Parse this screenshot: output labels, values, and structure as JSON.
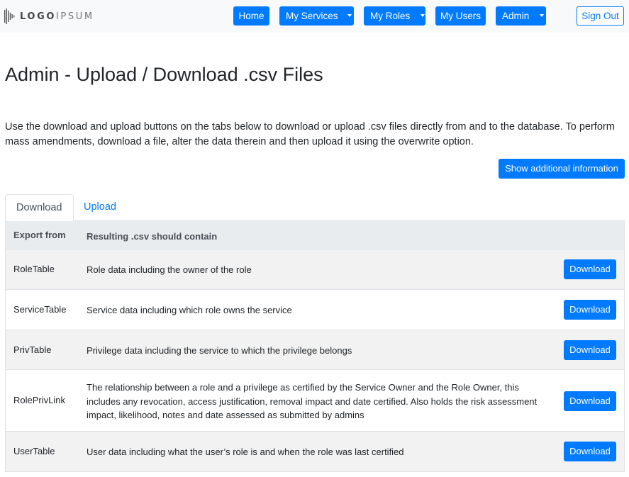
{
  "brand": {
    "logo_bold": "LOGO",
    "logo_light": "IPSUM"
  },
  "nav": {
    "home": "Home",
    "my_services": "My Services",
    "my_roles": "My Roles",
    "my_users": "My Users",
    "admin": "Admin",
    "sign_out": "Sign Out"
  },
  "page": {
    "title": "Admin - Upload / Download .csv Files",
    "intro": "Use the download and upload buttons on the tabs below to download or upload .csv files directly from and to the database. To perform mass amendments, download a file, alter the data therein and then upload it using the overwrite option.",
    "info_button": "Show additional information"
  },
  "tabs": [
    {
      "label": "Download",
      "active": true
    },
    {
      "label": "Upload",
      "active": false
    }
  ],
  "table": {
    "headers": [
      "Export from",
      "Resulting .csv should contain"
    ],
    "rows": [
      {
        "name": "RoleTable",
        "desc": "Role data including the owner of the role",
        "action": "Download"
      },
      {
        "name": "ServiceTable",
        "desc": "Service data including which role owns the service",
        "action": "Download"
      },
      {
        "name": "PrivTable",
        "desc": "Privilege data including the service to which the privilege belongs",
        "action": "Download"
      },
      {
        "name": "RolePrivLink",
        "desc": "The relationship between a role and a privilege as certified by the Service Owner and the Role Owner, this includes any revocation, access justification, removal impact and date certified. Also holds the risk assessment impact, likelihood, notes and date assessed as submitted by admins",
        "action": "Download"
      },
      {
        "name": "UserTable",
        "desc": "User data including what the user’s role is and when the role was last certified",
        "action": "Download"
      }
    ]
  },
  "colors": {
    "primary": "#007bff",
    "navbar_bg": "#f8f9fa",
    "stripe": "#f2f2f2",
    "header_bg": "#e9ecef"
  }
}
